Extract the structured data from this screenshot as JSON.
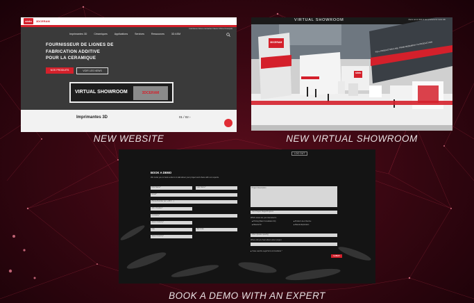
{
  "captions": {
    "website": "NEW WEBSITE",
    "showroom": "NEW VIRTUAL SHOWROOM",
    "demo": "BOOK A DEMO WITH AN EXPERT"
  },
  "website": {
    "logo": "sinto",
    "logo2": "3DCERAM",
    "subnav": "Carrières  Nous contacter  News  Chine  Français",
    "nav": [
      "Imprimantes 3D",
      "Céramiques",
      "Applications",
      "Services",
      "Ressources",
      "3D ASM"
    ],
    "hero": [
      "FOURNISSEUR DE LIGNES DE",
      "FABRICATION ADDITIVE",
      "POUR LA CERAMIQUE"
    ],
    "btn_products": "NOS PRODUITS",
    "btn_news": "VOIR LES NEWS",
    "vs_label": "VIRTUAL SHOWROOM",
    "vs_sign": "3DCERAM",
    "bottom_title": "Imprimantes 3D",
    "pager": "01 / 02 ›"
  },
  "showroom": {
    "title": "VIRTUAL SHOWROOM",
    "subtitle": "Zoom out or click to see products for more info",
    "booth_logo": "3DCERAM",
    "booth_logo2": "sinto",
    "wall_text": "FULL PRODUCTION LINE: FROM RESEARCH TO PRODUCTION"
  },
  "demo": {
    "logout": "LOG OUT",
    "heading": "BOOK A DEMO",
    "description": "We invite you to book a demo to talk about your project and share with our experts.",
    "fields_left": {
      "first_name": "First Name*",
      "last_name": "Last Name*",
      "email": "Email*",
      "phone": "Phone Number (ex: +33 6 ...)",
      "job": "Job / Position*",
      "company": "Company*",
      "industry": "Select Industry*",
      "city": "City",
      "zip": "Zip Code",
      "country": "Select Country*"
    },
    "project_description": "Project Description",
    "project_stage": "Your Project Stage/Progress",
    "interest_label": "Which areas are you interested in",
    "interests": [
      "Printing (Basic Consultation Kit)",
      "Product Line & Service",
      "Material Kit",
      "Material Exploration"
    ],
    "other": "Other (please specify)",
    "heard_label": "Where did you hear about us/our project",
    "consent": "I have read the Legal Terms & Conditions *",
    "submit": "SUBMIT"
  }
}
